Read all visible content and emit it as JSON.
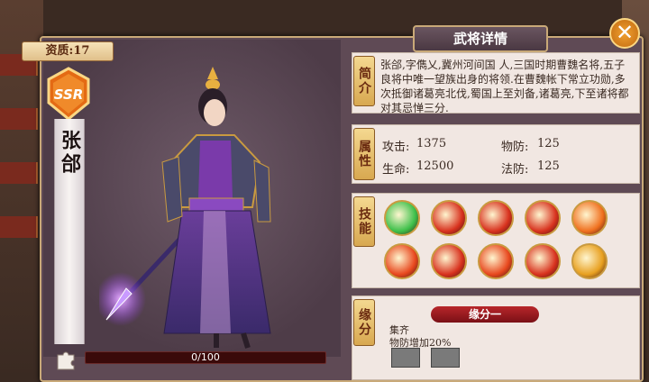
{
  "grade": {
    "label": "资质:17"
  },
  "hero": {
    "rank": "SSR",
    "name": "张郃"
  },
  "progress": {
    "text": "0/100",
    "value": 0,
    "max": 100
  },
  "window": {
    "title": "武将详情",
    "close_icon": "close-icon"
  },
  "sections": {
    "bio_label": "简介",
    "attr_label": "属性",
    "skill_label": "技能",
    "fate_label": "缘分"
  },
  "bio": {
    "text": "张郃,字儁乂,冀州河间国 人,三国时期曹魏名将,五子良将中唯一望族出身的将领.在曹魏帐下常立功勋,多次抵御诸葛亮北伐,蜀国上至刘备,诸葛亮,下至诸将都对其忌惮三分."
  },
  "attributes": {
    "attack_label": "攻击:",
    "attack": "1375",
    "phys_def_label": "物防:",
    "phys_def": "125",
    "hp_label": "生命:",
    "hp": "12500",
    "mag_def_label": "法防:",
    "mag_def": "125"
  },
  "skills": [
    {
      "icon": "green-slash-skill-icon",
      "color": "#3ec04a"
    },
    {
      "icon": "red-claw-skill-icon",
      "color": "#d8321e"
    },
    {
      "icon": "red-blade-skill-icon",
      "color": "#d8321e"
    },
    {
      "icon": "red-cross-skill-icon",
      "color": "#d8321e"
    },
    {
      "icon": "flame-swirl-skill-icon",
      "color": "#f0701e"
    },
    {
      "icon": "fire-burst-skill-icon",
      "color": "#e8481e"
    },
    {
      "icon": "twin-blade-skill-icon",
      "color": "#d8321e"
    },
    {
      "icon": "flame-crown-skill-icon",
      "color": "#e8481e"
    },
    {
      "icon": "fire-orb-skill-icon",
      "color": "#d8321e"
    },
    {
      "icon": "golden-blade-skill-icon",
      "color": "#e8a020"
    }
  ],
  "fate": {
    "title": "缘分一",
    "name": "集齐",
    "effect": "物防增加20%"
  }
}
